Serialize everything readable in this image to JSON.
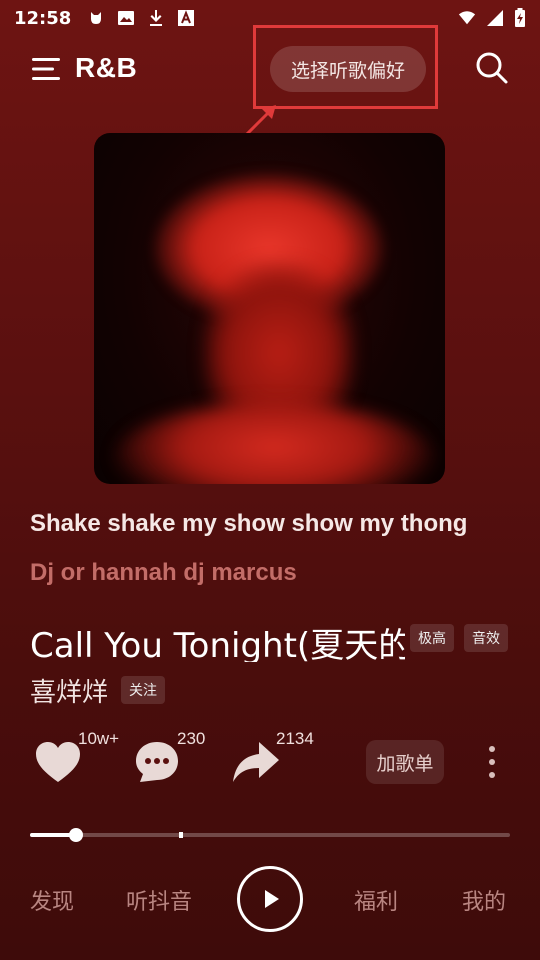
{
  "status_bar": {
    "time": "12:58",
    "icons": [
      "cat-notification-icon",
      "image-icon",
      "download-icon",
      "font-icon"
    ],
    "right_icons": [
      "wifi-icon",
      "signal-icon",
      "battery-charging-icon"
    ]
  },
  "header": {
    "genre": "R&B",
    "preference_button": "选择听歌偏好"
  },
  "lyrics": {
    "line1": "Shake shake my show show my thong",
    "line2": "Dj or hannah dj marcus"
  },
  "song": {
    "title": "Call You Tonight(夏天的",
    "tag_quality": "极高",
    "tag_effect": "音效",
    "artist": "喜烊烊",
    "follow_label": "关注"
  },
  "actions": {
    "like_count": "10w+",
    "comment_count": "230",
    "share_count": "2134",
    "add_playlist_label": "加歌单"
  },
  "progress": {
    "played_fraction": 0.095,
    "buffered_fraction": 0.31
  },
  "tabs": {
    "discover": "发现",
    "douyin": "听抖音",
    "welfare": "福利",
    "mine": "我的"
  },
  "colors": {
    "background": "#5a100f",
    "highlight_border": "#e03a3a",
    "lyric_secondary": "#c36d68"
  }
}
